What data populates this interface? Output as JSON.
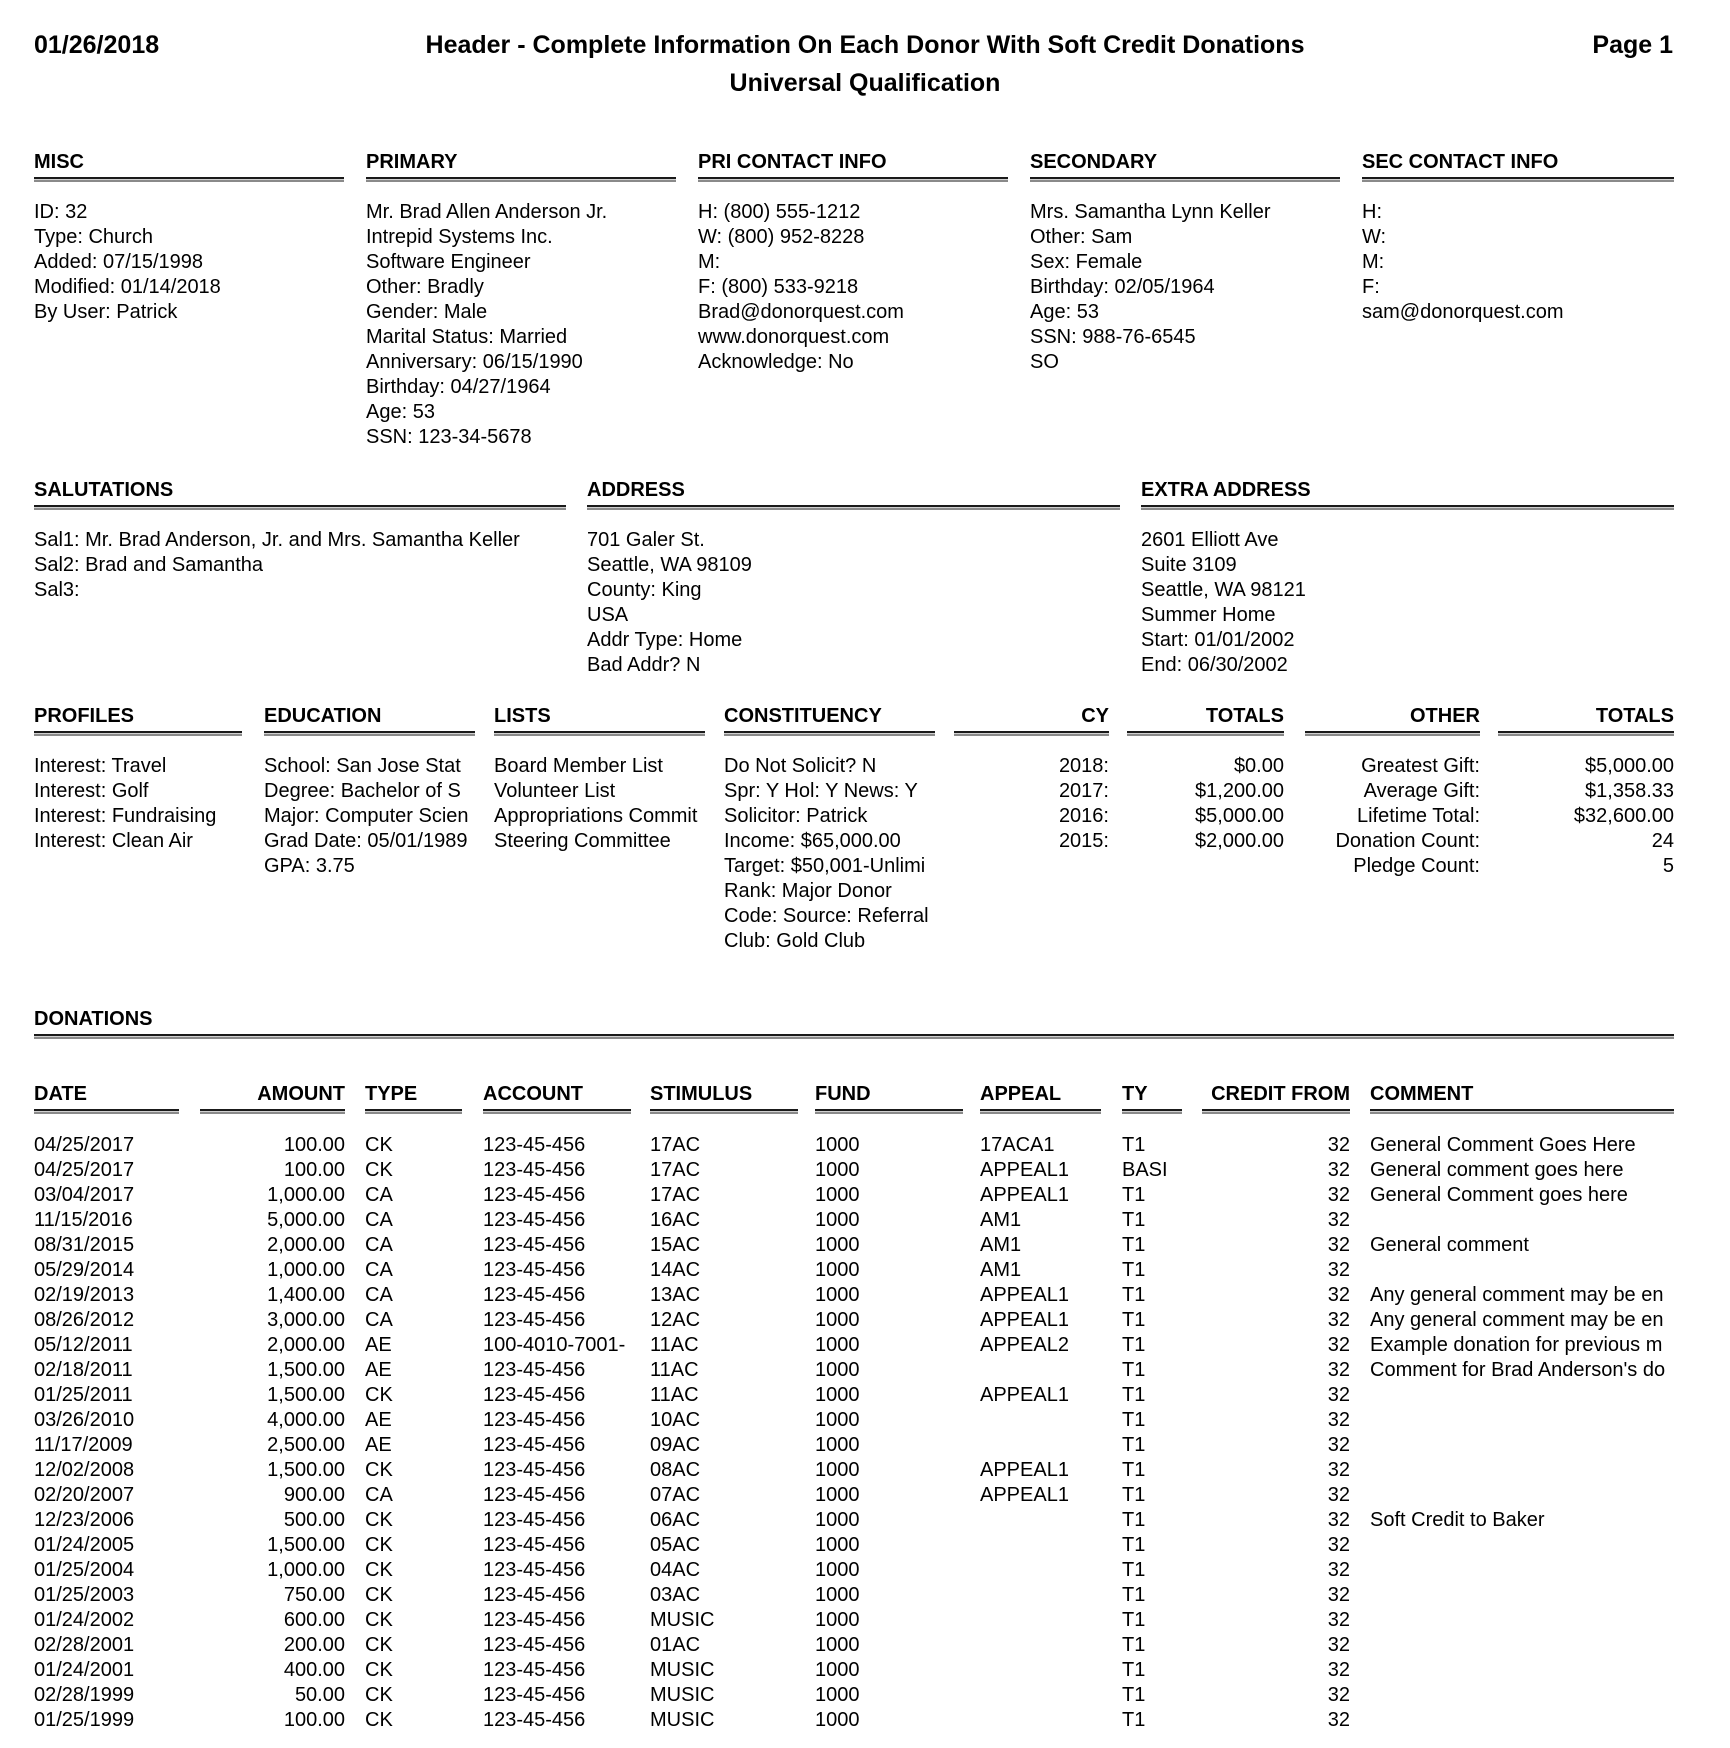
{
  "report": {
    "date": "01/26/2018",
    "title": "Header - Complete Information On Each Donor With Soft Credit Donations",
    "subtitle": "Universal Qualification",
    "page": "Page 1"
  },
  "sections": {
    "misc": {
      "title": "MISC",
      "lines": [
        "ID: 32",
        "Type: Church",
        "Added: 07/15/1998",
        "Modified: 01/14/2018",
        "By User: Patrick"
      ]
    },
    "primary": {
      "title": "PRIMARY",
      "lines": [
        "Mr. Brad Allen Anderson Jr.",
        "Intrepid Systems Inc.",
        "Software Engineer",
        "Other: Bradly",
        "Gender: Male",
        "Marital Status: Married",
        "Anniversary: 06/15/1990",
        "Birthday: 04/27/1964",
        "Age: 53",
        "SSN: 123-34-5678"
      ]
    },
    "pri_contact": {
      "title": "PRI CONTACT INFO",
      "lines": [
        "H: (800) 555-1212",
        "W: (800) 952-8228",
        "M:",
        "F: (800) 533-9218",
        "Brad@donorquest.com",
        "www.donorquest.com",
        "Acknowledge: No"
      ]
    },
    "secondary": {
      "title": "SECONDARY",
      "lines": [
        "Mrs. Samantha Lynn Keller",
        "Other: Sam",
        "Sex: Female",
        "Birthday: 02/05/1964",
        "Age: 53",
        "SSN: 988-76-6545",
        "SO"
      ]
    },
    "sec_contact": {
      "title": "SEC CONTACT INFO",
      "lines": [
        "H:",
        "W:",
        "M:",
        "F:",
        "sam@donorquest.com"
      ]
    },
    "salutations": {
      "title": "SALUTATIONS",
      "lines": [
        "Sal1: Mr. Brad Anderson, Jr.  and Mrs. Samantha Keller",
        "Sal2: Brad and Samantha",
        "Sal3:"
      ]
    },
    "address": {
      "title": "ADDRESS",
      "lines": [
        "701 Galer St.",
        "Seattle, WA 98109",
        "County: King",
        "USA",
        "Addr Type: Home",
        "Bad Addr? N"
      ]
    },
    "extra_address": {
      "title": "EXTRA ADDRESS",
      "lines": [
        "2601 Elliott Ave",
        "Suite 3109",
        "Seattle, WA 98121",
        "Summer Home",
        "Start: 01/01/2002",
        "End: 06/30/2002"
      ]
    },
    "profiles": {
      "title": "PROFILES",
      "lines": [
        "Interest: Travel",
        "Interest: Golf",
        "Interest: Fundraising",
        "Interest: Clean Air"
      ]
    },
    "education": {
      "title": "EDUCATION",
      "lines": [
        "School: San Jose Stat",
        "Degree: Bachelor of S",
        "Major: Computer Scien",
        "Grad Date: 05/01/1989",
        "GPA: 3.75"
      ]
    },
    "lists": {
      "title": "LISTS",
      "lines": [
        "Board Member List",
        "Volunteer List",
        "Appropriations Commit",
        "Steering Committee"
      ]
    },
    "constituency": {
      "title": "CONSTITUENCY",
      "lines": [
        "Do Not Solicit? N",
        "Spr: Y Hol: Y News: Y",
        "Solicitor: Patrick",
        "Income: $65,000.00",
        "Target: $50,001-Unlimi",
        "Rank: Major Donor",
        "Code: Source: Referral",
        "Club: Gold Club"
      ]
    },
    "cy": {
      "title": "CY",
      "lines": [
        "2018:",
        "2017:",
        "2016:",
        "2015:"
      ]
    },
    "cy_totals": {
      "title": "TOTALS",
      "lines": [
        "$0.00",
        "$1,200.00",
        "$5,000.00",
        "$2,000.00"
      ]
    },
    "other": {
      "title": "OTHER",
      "lines": [
        "Greatest Gift:",
        "Average Gift:",
        "Lifetime Total:",
        "Donation Count:",
        "Pledge Count:"
      ]
    },
    "other_totals": {
      "title": "TOTALS",
      "lines": [
        "$5,000.00",
        "$1,358.33",
        "$32,600.00",
        "24",
        "5"
      ]
    }
  },
  "donations": {
    "title": "DONATIONS",
    "columns": [
      "DATE",
      "AMOUNT",
      "TYPE",
      "ACCOUNT",
      "STIMULUS",
      "FUND",
      "APPEAL",
      "TY",
      "CREDIT FROM",
      "COMMENT"
    ],
    "rows": [
      [
        "04/25/2017",
        "100.00",
        "CK",
        "123-45-456",
        "17AC",
        "1000",
        "17ACA1",
        "T1",
        "32",
        "General Comment Goes Here"
      ],
      [
        "04/25/2017",
        "100.00",
        "CK",
        "123-45-456",
        "17AC",
        "1000",
        "APPEAL1",
        "BASI",
        "32",
        "General comment goes here"
      ],
      [
        "03/04/2017",
        "1,000.00",
        "CA",
        "123-45-456",
        "17AC",
        "1000",
        "APPEAL1",
        "T1",
        "32",
        "General Comment goes here"
      ],
      [
        "11/15/2016",
        "5,000.00",
        "CA",
        "123-45-456",
        "16AC",
        "1000",
        "AM1",
        "T1",
        "32",
        ""
      ],
      [
        "08/31/2015",
        "2,000.00",
        "CA",
        "123-45-456",
        "15AC",
        "1000",
        "AM1",
        "T1",
        "32",
        "General comment"
      ],
      [
        "05/29/2014",
        "1,000.00",
        "CA",
        "123-45-456",
        "14AC",
        "1000",
        "AM1",
        "T1",
        "32",
        ""
      ],
      [
        "02/19/2013",
        "1,400.00",
        "CA",
        "123-45-456",
        "13AC",
        "1000",
        "APPEAL1",
        "T1",
        "32",
        "Any general comment may be en"
      ],
      [
        "08/26/2012",
        "3,000.00",
        "CA",
        "123-45-456",
        "12AC",
        "1000",
        "APPEAL1",
        "T1",
        "32",
        "Any general comment may be en"
      ],
      [
        "05/12/2011",
        "2,000.00",
        "AE",
        "100-4010-7001-",
        "11AC",
        "1000",
        "APPEAL2",
        "T1",
        "32",
        "Example donation for previous m"
      ],
      [
        "02/18/2011",
        "1,500.00",
        "AE",
        "123-45-456",
        "11AC",
        "1000",
        "",
        "T1",
        "32",
        "Comment for Brad Anderson's do"
      ],
      [
        "01/25/2011",
        "1,500.00",
        "CK",
        "123-45-456",
        "11AC",
        "1000",
        "APPEAL1",
        "T1",
        "32",
        ""
      ],
      [
        "03/26/2010",
        "4,000.00",
        "AE",
        "123-45-456",
        "10AC",
        "1000",
        "",
        "T1",
        "32",
        ""
      ],
      [
        "11/17/2009",
        "2,500.00",
        "AE",
        "123-45-456",
        "09AC",
        "1000",
        "",
        "T1",
        "32",
        ""
      ],
      [
        "12/02/2008",
        "1,500.00",
        "CK",
        "123-45-456",
        "08AC",
        "1000",
        "APPEAL1",
        "T1",
        "32",
        ""
      ],
      [
        "02/20/2007",
        "900.00",
        "CA",
        "123-45-456",
        "07AC",
        "1000",
        "APPEAL1",
        "T1",
        "32",
        ""
      ],
      [
        "12/23/2006",
        "500.00",
        "CK",
        "123-45-456",
        "06AC",
        "1000",
        "",
        "T1",
        "32",
        "Soft Credit to Baker"
      ],
      [
        "01/24/2005",
        "1,500.00",
        "CK",
        "123-45-456",
        "05AC",
        "1000",
        "",
        "T1",
        "32",
        ""
      ],
      [
        "01/25/2004",
        "1,000.00",
        "CK",
        "123-45-456",
        "04AC",
        "1000",
        "",
        "T1",
        "32",
        ""
      ],
      [
        "01/25/2003",
        "750.00",
        "CK",
        "123-45-456",
        "03AC",
        "1000",
        "",
        "T1",
        "32",
        ""
      ],
      [
        "01/24/2002",
        "600.00",
        "CK",
        "123-45-456",
        "MUSIC",
        "1000",
        "",
        "T1",
        "32",
        ""
      ],
      [
        "02/28/2001",
        "200.00",
        "CK",
        "123-45-456",
        "01AC",
        "1000",
        "",
        "T1",
        "32",
        ""
      ],
      [
        "01/24/2001",
        "400.00",
        "CK",
        "123-45-456",
        "MUSIC",
        "1000",
        "",
        "T1",
        "32",
        ""
      ],
      [
        "02/28/1999",
        "50.00",
        "CK",
        "123-45-456",
        "MUSIC",
        "1000",
        "",
        "T1",
        "32",
        ""
      ],
      [
        "01/25/1999",
        "100.00",
        "CK",
        "123-45-456",
        "MUSIC",
        "1000",
        "",
        "T1",
        "32",
        ""
      ]
    ]
  }
}
